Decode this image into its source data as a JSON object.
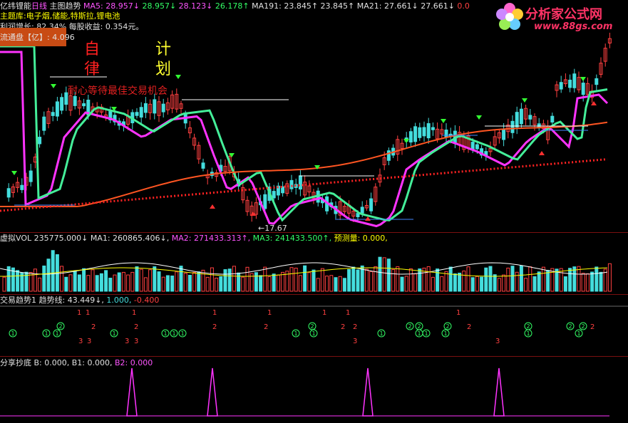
{
  "header": {
    "stock_name": "亿纬锂能",
    "period": "日线",
    "indicator": "主图趋势",
    "ma5_label": "MA5:",
    "ma5_values": [
      "28.957↓",
      "28.957↓",
      "28.123↓",
      "26.178↑"
    ],
    "ma191_label": "MA191:",
    "ma191_values": [
      "23.845↑",
      "23.845↑"
    ],
    "ma21_label": "MA21:",
    "ma21_values": [
      "27.661↓",
      "27.661↓",
      "0.0"
    ]
  },
  "info": {
    "theme": "主题库:电子烟,储能,特斯拉,锂电池",
    "profit": "利润增长: 82.34%  每股收益: 0.354元。",
    "float_label": "流通盘【亿】:",
    "float_value": "4.096"
  },
  "overlay": {
    "left_col": [
      "自",
      "律"
    ],
    "right_col": [
      "计",
      "划"
    ],
    "slogan": "耐心等待最佳交易机会",
    "low_label": "17.67"
  },
  "volume_pane": {
    "title": "虚拟VOL",
    "value": "235775.000↓",
    "ma1": "MA1: 260865.406↓,",
    "ma2": "MA2: 271433.313↑,",
    "ma3": "MA3: 241433.500↑,",
    "forecast": "预测量: 0.000,"
  },
  "trend_pane": {
    "title": "交易趋势1",
    "line_label": "趋势线:",
    "line_value": "43.449↓,",
    "v1": "1.000,",
    "v2": "-0.400"
  },
  "bottom_pane": {
    "title": "分享抄底",
    "b": "B: 0.000,",
    "b1": "B1: 0.000,",
    "b2": "B2: 0.000"
  },
  "logo": {
    "title": "分析家公式网",
    "url": "www.88gs.com"
  },
  "colors": {
    "up": "#ff4040",
    "down": "#44dddd",
    "ma_pink": "#ff33ff",
    "ma_green": "#44ee99",
    "ma_orange": "#ff5522"
  }
}
